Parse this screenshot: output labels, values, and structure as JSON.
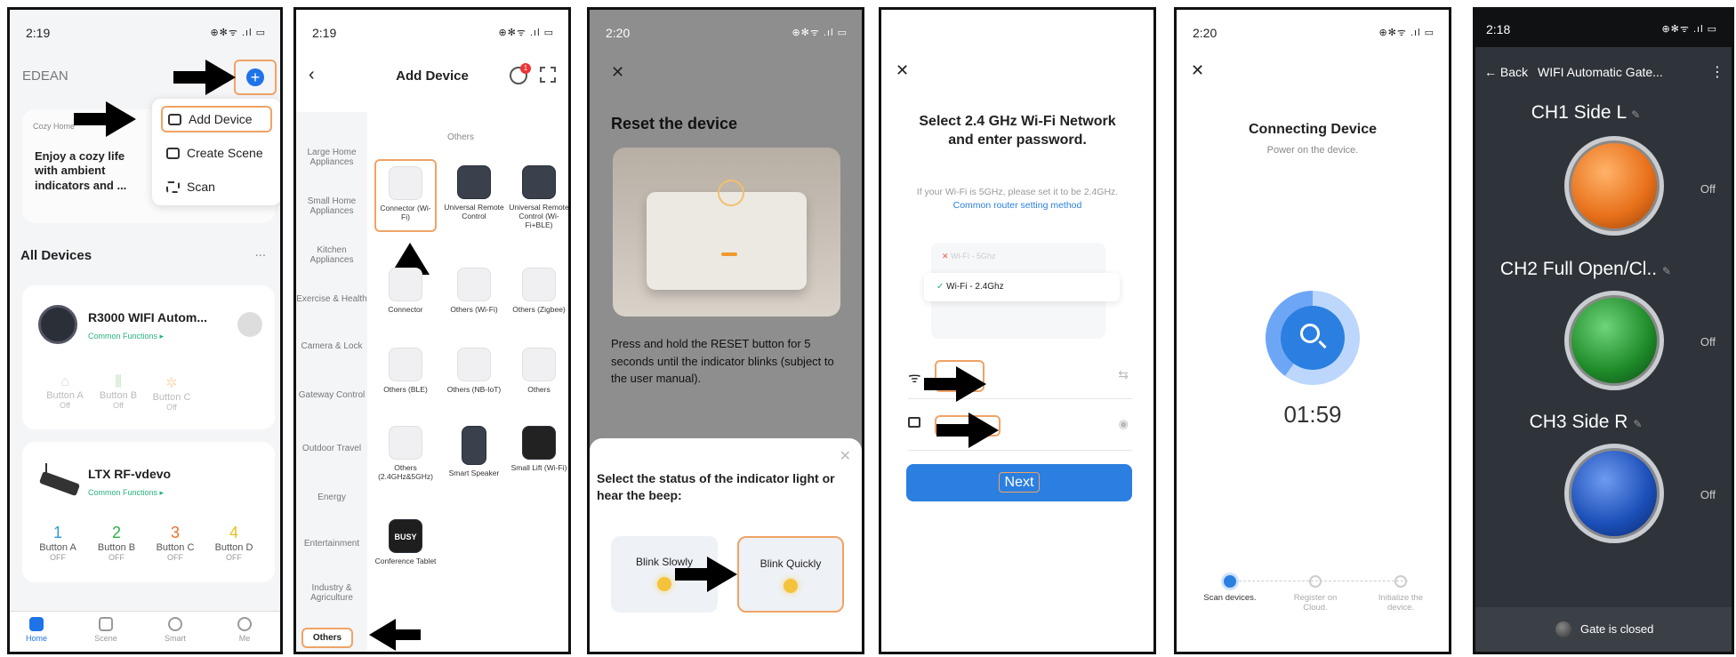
{
  "panel1": {
    "time": "2:19",
    "status_icons": "⊕✻ᯤ .ıl ▭",
    "home_name": "EDEAN",
    "menu": {
      "add_device": "Add Device",
      "create_scene": "Create Scene",
      "scan": "Scan"
    },
    "banner": {
      "tag": "Cozy Home",
      "text": "Enjoy a cozy life with ambient indicators and ..."
    },
    "all_devices": "All Devices",
    "more": "...",
    "device1": {
      "name": "R3000 WIFI Autom...",
      "sub": "Common Functions ▸",
      "buttons": [
        {
          "label": "Button A",
          "state": "Off"
        },
        {
          "label": "Button B",
          "state": "Off"
        },
        {
          "label": "Button C",
          "state": "Off"
        }
      ]
    },
    "device2": {
      "name": "LTX RF-vdevo",
      "sub": "Common Functions ▸",
      "buttons": [
        {
          "num": "1",
          "label": "Button A",
          "state": "OFF"
        },
        {
          "num": "2",
          "label": "Button B",
          "state": "OFF"
        },
        {
          "num": "3",
          "label": "Button C",
          "state": "OFF"
        },
        {
          "num": "4",
          "label": "Button D",
          "state": "OFF"
        }
      ]
    },
    "tabs": [
      "Home",
      "Scene",
      "Smart",
      "Me"
    ]
  },
  "panel2": {
    "time": "2:19",
    "title": "Add Device",
    "badge": "1",
    "section": "Others",
    "categories": [
      "Large Home Appliances",
      "Small Home Appliances",
      "Kitchen Appliances",
      "Exercise & Health",
      "Camera & Lock",
      "Gateway Control",
      "Outdoor Travel",
      "Energy",
      "Entertainment",
      "Industry & Agriculture",
      "Others"
    ],
    "devices": [
      "Connector (Wi-Fi)",
      "Universal Remote Control",
      "Universal Remote Control (Wi-Fi+BLE)",
      "Connector",
      "Others (Wi-Fi)",
      "Others (Zigbee)",
      "Others (BLE)",
      "Others (NB-IoT)",
      "Others",
      "Others (2.4GHz&5GHz)",
      "Smart Speaker",
      "Small Lift (Wi-Fi)",
      "Conference Tablet"
    ],
    "busy": "BUSY"
  },
  "panel3": {
    "time": "2:20",
    "close": "✕",
    "title": "Reset the device",
    "body": "Press and hold the RESET button for 5 seconds until the indicator blinks (subject to the user manual).",
    "sheet_title": "Select the status of the indicator light or hear the beep:",
    "options": [
      "Blink Slowly",
      "Blink Quickly"
    ]
  },
  "panel4": {
    "close": "✕",
    "title": "Select 2.4 GHz Wi-Fi Network and enter password.",
    "hint": "If your Wi-Fi is 5GHz, please set it to be 2.4GHz.",
    "hint_link": "Common router setting method",
    "wifi_bad": "Wi-Fi - 5Ghz",
    "wifi_good": "Wi-Fi - 2.4Ghz",
    "next": "Next"
  },
  "panel5": {
    "time": "2:20",
    "close": "✕",
    "title": "Connecting Device",
    "sub": "Power on the device.",
    "timer": "01:59",
    "steps": [
      "Scan devices.",
      "Register on Cloud.",
      "Initialize the device."
    ]
  },
  "panel6": {
    "time": "2:18",
    "back": "← Back",
    "title": "WIFI Automatic Gate...",
    "channels": [
      {
        "name": "CH1 Side L",
        "state": "Off",
        "color": "#e8701a"
      },
      {
        "name": "CH2 Full Open/Cl..",
        "state": "Off",
        "color": "#1f8c2a"
      },
      {
        "name": "CH3 Side R",
        "state": "Off",
        "color": "#1c4fb8"
      }
    ],
    "footer": "Gate is closed"
  }
}
